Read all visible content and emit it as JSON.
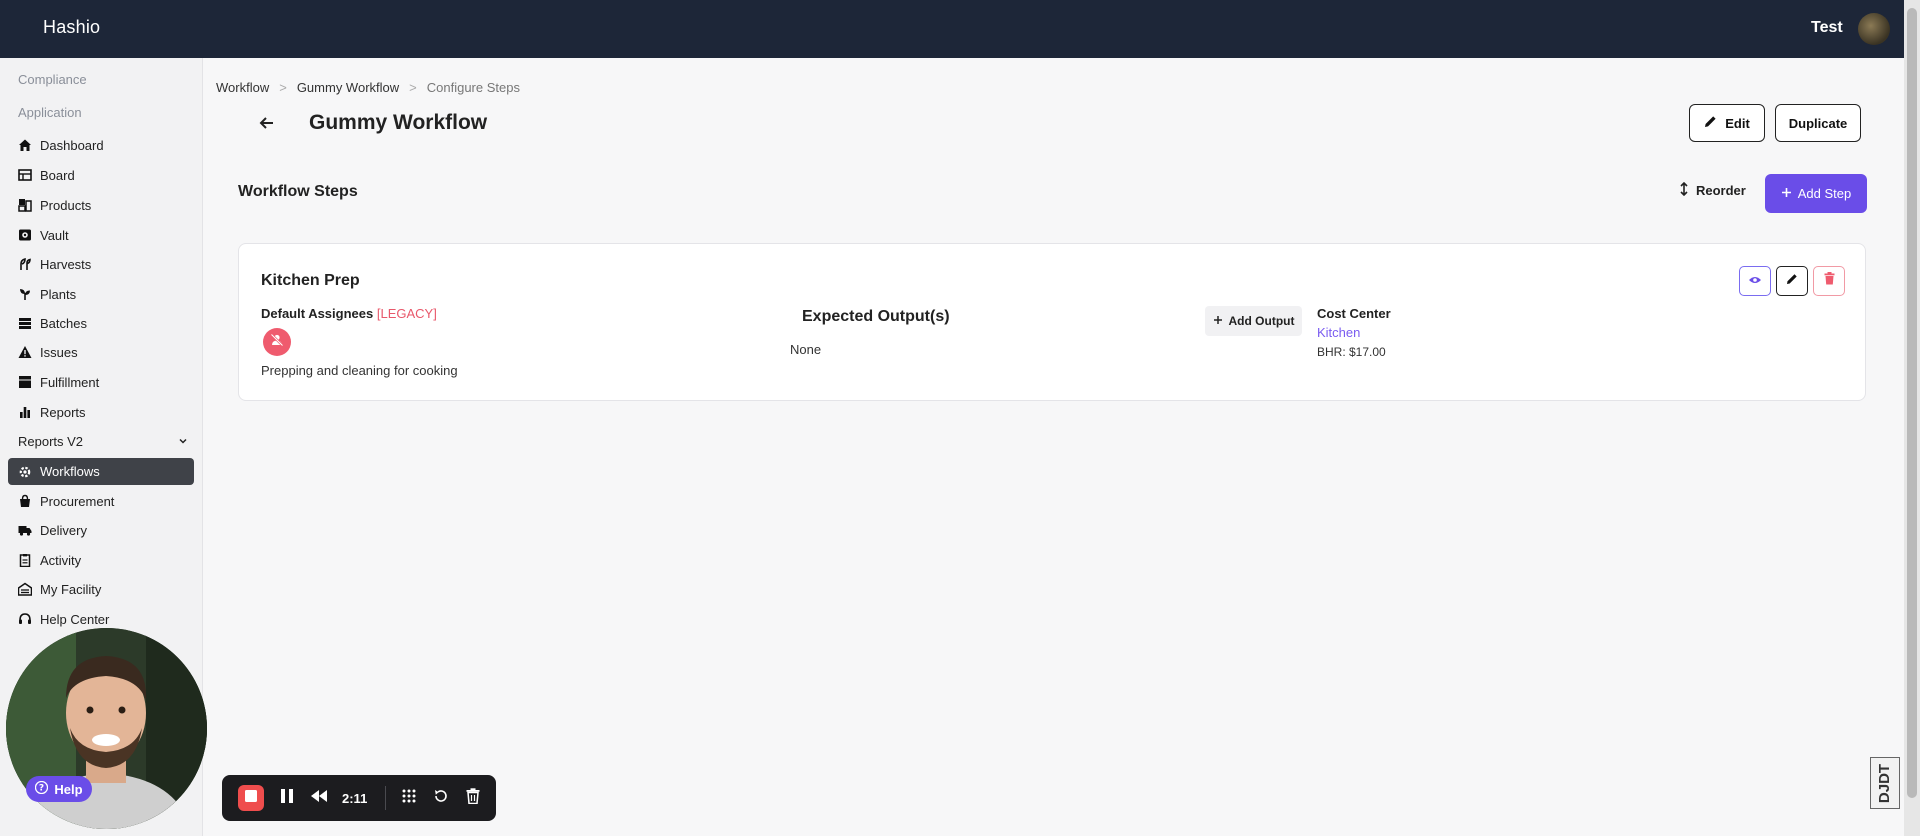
{
  "app": {
    "brand": "Hashio",
    "user": "Test"
  },
  "sidebar": {
    "sections": [
      "Compliance",
      "Application"
    ],
    "items": [
      {
        "label": "Dashboard",
        "icon": "home-icon"
      },
      {
        "label": "Board",
        "icon": "board-icon"
      },
      {
        "label": "Products",
        "icon": "products-icon"
      },
      {
        "label": "Vault",
        "icon": "vault-icon"
      },
      {
        "label": "Harvests",
        "icon": "harvest-icon"
      },
      {
        "label": "Plants",
        "icon": "plant-icon"
      },
      {
        "label": "Batches",
        "icon": "batches-icon"
      },
      {
        "label": "Issues",
        "icon": "warning-icon"
      },
      {
        "label": "Fulfillment",
        "icon": "box-icon"
      },
      {
        "label": "Reports",
        "icon": "bar-chart-icon"
      },
      {
        "label": "Reports V2",
        "icon": "chevron-down-icon"
      },
      {
        "label": "Workflows",
        "icon": "workflow-icon",
        "active": true
      },
      {
        "label": "Procurement",
        "icon": "bag-icon"
      },
      {
        "label": "Delivery",
        "icon": "truck-icon"
      },
      {
        "label": "Activity",
        "icon": "clipboard-icon"
      },
      {
        "label": "My Facility",
        "icon": "facility-icon"
      },
      {
        "label": "Help Center",
        "icon": "headset-icon"
      }
    ]
  },
  "breadcrumb": [
    "Workflow",
    "Gummy Workflow",
    "Configure Steps"
  ],
  "page": {
    "title": "Gummy Workflow",
    "edit_label": "Edit",
    "duplicate_label": "Duplicate",
    "section_title": "Workflow Steps",
    "reorder_label": "Reorder",
    "add_step_label": "Add Step"
  },
  "step": {
    "title": "Kitchen Prep",
    "assignees_label": "Default Assignees",
    "legacy_tag": "[LEGACY]",
    "description": "Prepping and cleaning for cooking",
    "outputs_title": "Expected Output(s)",
    "outputs_value": "None",
    "add_output_label": "Add Output",
    "cost_center_label": "Cost Center",
    "cost_center_name": "Kitchen",
    "cost_center_rate": "BHR: $17.00"
  },
  "overlay": {
    "help_label": "Help",
    "recorder_time": "2:11",
    "corner_badge": "DJDT"
  },
  "colors": {
    "topbar": "#1d2638",
    "accent": "#6a4de8",
    "danger": "#ef5b6e",
    "link": "#7a5cf0"
  }
}
